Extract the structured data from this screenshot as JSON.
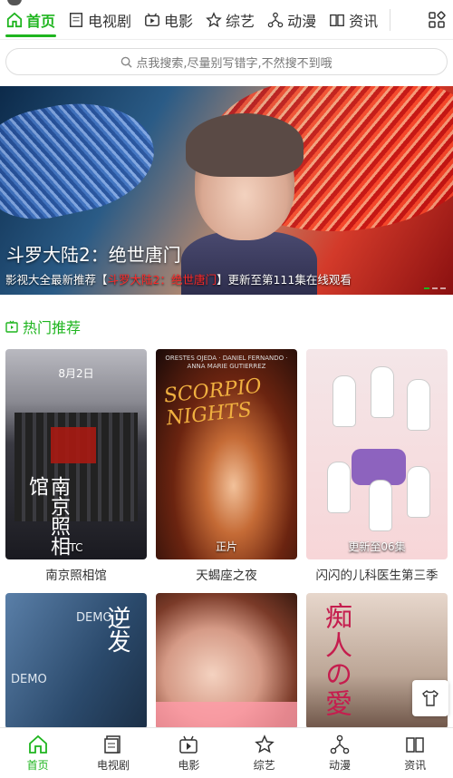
{
  "colors": {
    "accent": "#1fb51f",
    "highlight": "#ff2a2a"
  },
  "topnav": {
    "items": [
      {
        "label": "首页",
        "icon": "home-icon",
        "active": true
      },
      {
        "label": "电视剧",
        "icon": "tv-series-icon"
      },
      {
        "label": "电影",
        "icon": "movie-icon"
      },
      {
        "label": "综艺",
        "icon": "star-icon"
      },
      {
        "label": "动漫",
        "icon": "anime-icon"
      },
      {
        "label": "资讯",
        "icon": "news-icon"
      }
    ],
    "grid_icon": "grid-icon"
  },
  "search": {
    "placeholder": "点我搜索,尽量别写错字,不然搜不到哦"
  },
  "banner": {
    "title": "斗罗大陆2：绝世唐门",
    "sub_prefix": "影视大全最新推荐【",
    "sub_highlight": "斗罗大陆2：绝世唐门",
    "sub_suffix": "】更新至第111集在线观看"
  },
  "section": {
    "title": "热门推荐",
    "icon": "hot-icon"
  },
  "cards": [
    {
      "name": "南京照相馆",
      "tag": "TC",
      "poster_text": "南京照相馆",
      "poster_date": "8月2日"
    },
    {
      "name": "天蝎座之夜",
      "tag": "正片",
      "poster_text": "SCORPIO NIGHTS",
      "poster_cast": "ORESTES OJEDA · DANIEL FERNANDO · ANNA MARIE GUTIERREZ"
    },
    {
      "name": "闪闪的儿科医生第三季",
      "tag": "更新至06集"
    },
    {
      "name": "",
      "poster_text": "逆发",
      "demo": "DEMO"
    },
    {
      "name": ""
    },
    {
      "name": "",
      "poster_text": "痴人の愛"
    }
  ],
  "bottomnav": {
    "items": [
      {
        "label": "首页",
        "icon": "home-icon",
        "active": true
      },
      {
        "label": "电视剧",
        "icon": "tv-series-icon"
      },
      {
        "label": "电影",
        "icon": "movie-icon"
      },
      {
        "label": "综艺",
        "icon": "star-icon"
      },
      {
        "label": "动漫",
        "icon": "anime-icon"
      },
      {
        "label": "资讯",
        "icon": "news-icon"
      }
    ]
  },
  "fab": {
    "icon": "shirt-icon"
  }
}
